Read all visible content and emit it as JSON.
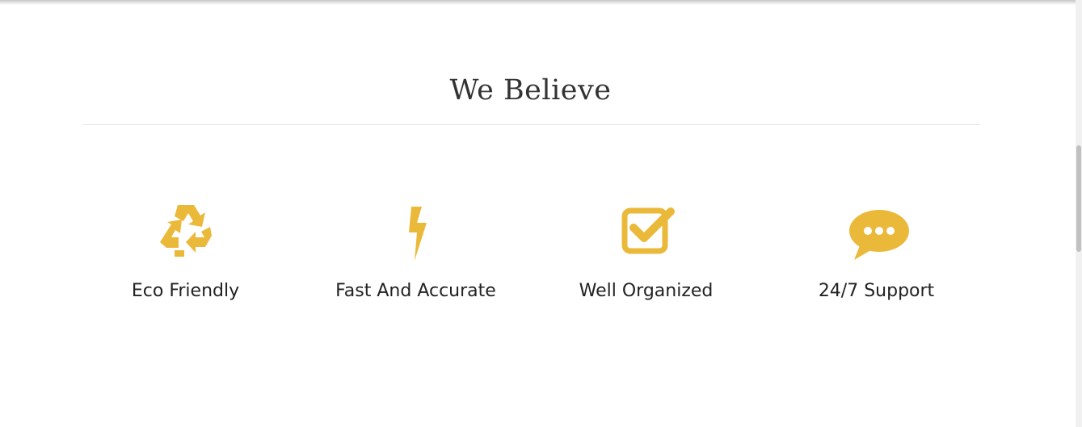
{
  "section": {
    "title": "We Believe"
  },
  "theme": {
    "accent": "#ebb93a"
  },
  "features": [
    {
      "label": "Eco Friendly",
      "icon": "recycle-icon"
    },
    {
      "label": "Fast And Accurate",
      "icon": "lightning-bolt-icon"
    },
    {
      "label": "Well Organized",
      "icon": "checkbox-checked-icon"
    },
    {
      "label": "24/7 Support",
      "icon": "speech-bubble-icon"
    }
  ]
}
